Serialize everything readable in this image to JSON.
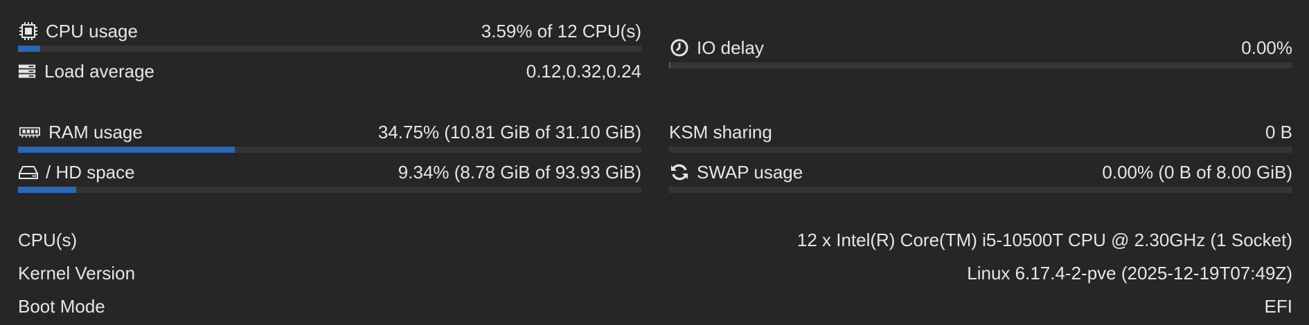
{
  "left": {
    "cpu_usage": {
      "label": "CPU usage",
      "value": "3.59% of 12 CPU(s)",
      "percent": 3.59,
      "icon": "cpu-icon"
    },
    "load_average": {
      "label": "Load average",
      "value": "0.12,0.32,0.24",
      "icon": "server-icon"
    },
    "ram_usage": {
      "label": "RAM usage",
      "value": "34.75% (10.81 GiB of 31.10 GiB)",
      "percent": 34.75,
      "icon": "memory-icon"
    },
    "hd_space": {
      "label": "/ HD space",
      "value": "9.34% (8.78 GiB of 93.93 GiB)",
      "percent": 9.34,
      "icon": "hdd-icon"
    }
  },
  "right": {
    "io_delay": {
      "label": "IO delay",
      "value": "0.00%",
      "percent": 0.0,
      "icon": "clock-icon"
    },
    "ksm_sharing": {
      "label": "KSM sharing",
      "value": "0 B"
    },
    "swap_usage": {
      "label": "SWAP usage",
      "value": "0.00% (0 B of 8.00 GiB)",
      "percent": 0.0,
      "icon": "refresh-icon"
    }
  },
  "info": [
    {
      "label": "CPU(s)",
      "value": "12 x Intel(R) Core(TM) i5-10500T CPU @ 2.30GHz (1 Socket)"
    },
    {
      "label": "Kernel Version",
      "value": "Linux 6.17.4-2-pve (2025-12-19T07:49Z)"
    },
    {
      "label": "Boot Mode",
      "value": "EFI"
    }
  ],
  "colors": {
    "background": "#262626",
    "bar_track": "#353535",
    "bar_fill": "#2c67b3",
    "text": "#e6e6e6"
  }
}
